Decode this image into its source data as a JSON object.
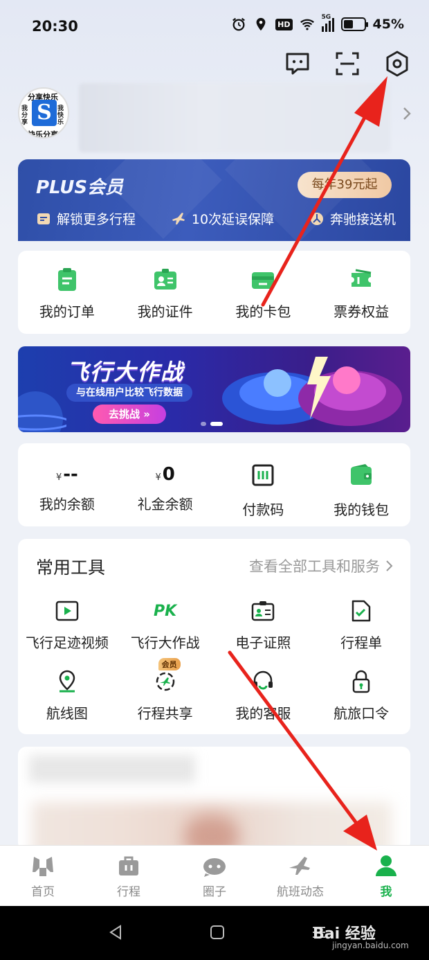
{
  "status": {
    "time": "20:30",
    "hd": "HD",
    "network": "5G",
    "battery": "45%",
    "battery_level": 0.45
  },
  "header": {
    "icons": [
      "message-icon",
      "scan-icon",
      "settings-icon"
    ]
  },
  "profile": {
    "avatar_center": "S",
    "avatar_top": "分享快乐",
    "avatar_bottom": "快乐分享",
    "avatar_left": "我分享",
    "avatar_right": "我快乐"
  },
  "plus": {
    "title": "PLUS会员",
    "price": "每年39元起",
    "benefits": [
      "解锁更多行程",
      "10次延误保障",
      "奔驰接送机"
    ]
  },
  "quick": {
    "items": [
      "我的订单",
      "我的证件",
      "我的卡包",
      "票券权益"
    ]
  },
  "banner": {
    "title": "飞行大作战",
    "subtitle": "与在线用户比较飞行数据",
    "button": "去挑战 »"
  },
  "wallet": {
    "balance_cur": "¥",
    "balance_val": "--",
    "gift_cur": "¥",
    "gift_val": "0",
    "items": [
      "我的余额",
      "礼金余额",
      "付款码",
      "我的钱包"
    ]
  },
  "tools": {
    "title": "常用工具",
    "more": "查看全部工具和服务",
    "pk": "PK",
    "member_tag": "会员",
    "row1": [
      "飞行足迹视频",
      "飞行大作战",
      "电子证照",
      "行程单"
    ],
    "row2": [
      "航线图",
      "行程共享",
      "我的客服",
      "航旅口令"
    ]
  },
  "tabs": [
    "首页",
    "行程",
    "圈子",
    "航班动态",
    "我"
  ],
  "watermark": {
    "brand": "Bai 经验",
    "url": "jingyan.baidu.com"
  },
  "colors": {
    "accent": "#19b14c",
    "plus_bg": "#2f4fa8",
    "arrow": "#e8231c"
  }
}
